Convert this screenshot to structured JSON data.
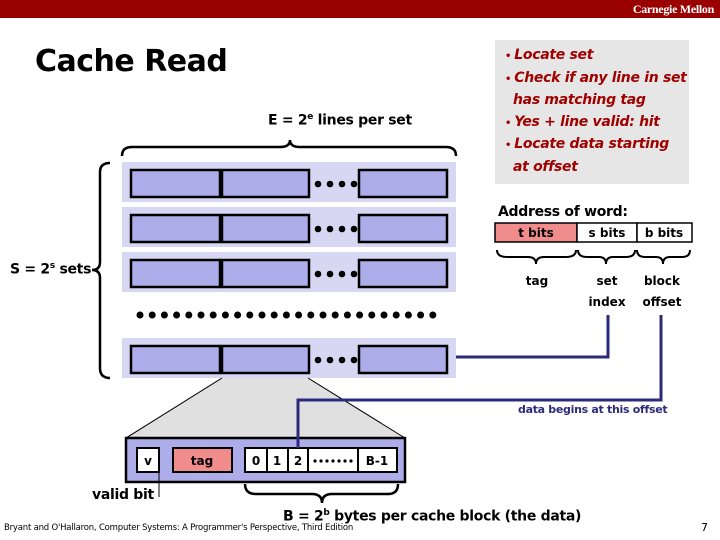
{
  "header": {
    "brand": "Carnegie Mellon"
  },
  "slide": {
    "title": "Cache Read",
    "page_number": "7",
    "footer": "Bryant and O'Hallaron, Computer Systems: A Programmer's Perspective, Third Edition"
  },
  "callout": {
    "bullets": [
      "Locate set",
      "Check if any line in set has matching tag",
      "Yes + line valid: hit",
      "Locate data starting at offset"
    ]
  },
  "cache": {
    "lines_label_prefix": "E = 2",
    "lines_label_exp": "e",
    "lines_label_suffix": " lines per set",
    "sets_label_prefix": "S = 2",
    "sets_label_exp": "s",
    "sets_label_suffix": " sets",
    "visible_sets": 4,
    "lines_per_set_shown": 3
  },
  "address": {
    "title": "Address of word:",
    "fields": [
      {
        "label": "t bits",
        "name": "tag",
        "desc_line1": "tag",
        "desc_line2": "",
        "color": "#f08c8c"
      },
      {
        "label": "s bits",
        "name": "set",
        "desc_line1": "set",
        "desc_line2": "index",
        "color": "#ffffff"
      },
      {
        "label": "b bits",
        "name": "block",
        "desc_line1": "block",
        "desc_line2": "offset",
        "color": "#ffffff"
      }
    ],
    "data_begins_label": "data begins at this offset"
  },
  "line_detail": {
    "valid_label": "v",
    "tag_label": "tag",
    "bytes": [
      "0",
      "1",
      "2",
      "B-1"
    ],
    "valid_bit_caption": "valid bit",
    "block_label_prefix": "B = 2",
    "block_label_exp": "b",
    "block_label_suffix": " bytes per cache block (the data)"
  },
  "colors": {
    "brand_bar": "#990000",
    "set_background": "#d7d7f4",
    "line_fill": "#adadea",
    "tag_fill": "#f08c8c",
    "pointer_line": "#2b2b7a",
    "callout_text": "#a00000"
  }
}
